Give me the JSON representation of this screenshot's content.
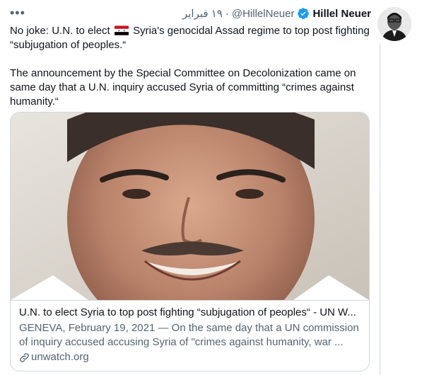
{
  "tweet": {
    "display_name": "Hillel Neuer",
    "handle": "@HillelNeuer",
    "separator": "·",
    "date": "١٩ فبراير",
    "more_icon": "more-dots-icon",
    "verified_icon": "verified-badge-icon",
    "text_part1_before_flag": "No joke: U.N. to elect ",
    "text_part1_after_flag": " Syria's genocidal Assad regime to top post fighting “subjugation of peoples.“",
    "text_part2": "The announcement by the Special Committee on Decolonization came on same day that a U.N. inquiry accused Syria of committing “crimes against humanity.“",
    "flag_icon": "syria-flag-icon"
  },
  "card": {
    "title": "U.N. to elect Syria to top post fighting “subjugation of peoples“ - UN W...",
    "description": "GENEVA, February 19, 2021 — On the same day that a UN commission of inquiry accused accusing Syria of \"crimes against humanity, war ...",
    "domain": "unwatch.org",
    "link_icon": "link-icon"
  },
  "colors": {
    "text_primary": "#0f1419",
    "text_secondary": "#536471",
    "verified_blue": "#1d9bf0",
    "border": "#cfd9de"
  }
}
